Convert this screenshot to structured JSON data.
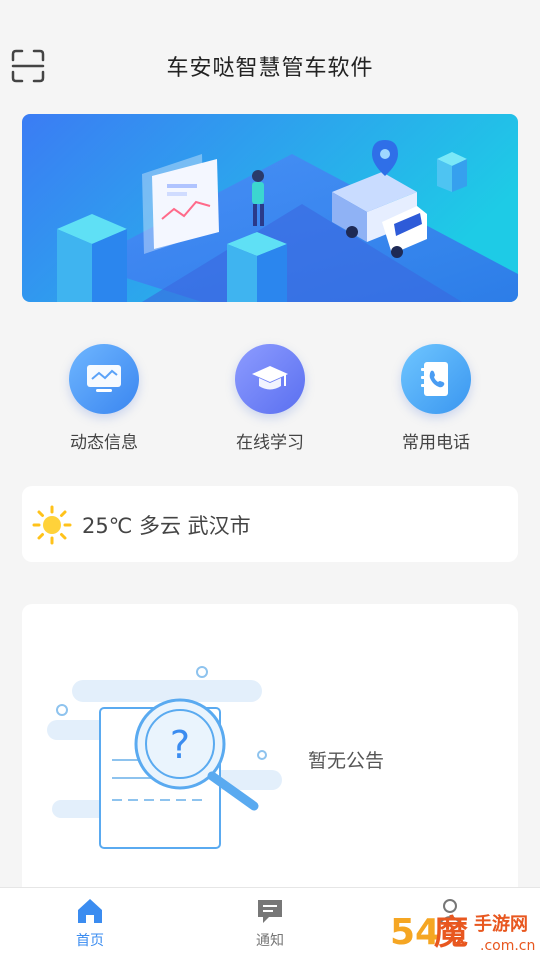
{
  "header": {
    "title": "车安哒智慧管车软件",
    "scan_icon": "scan-icon"
  },
  "quick_menu": [
    {
      "label": "动态信息",
      "icon": "monitor-icon"
    },
    {
      "label": "在线学习",
      "icon": "graduation-cap-icon"
    },
    {
      "label": "常用电话",
      "icon": "phone-book-icon"
    }
  ],
  "weather": {
    "icon": "sun-icon",
    "text": "25℃ 多云 武汉市"
  },
  "notice": {
    "empty_text": "暂无公告",
    "illustration": "magnifier-question-document-illustration"
  },
  "tabbar": [
    {
      "label": "首页",
      "icon": "home-icon",
      "active": true
    },
    {
      "label": "通知",
      "icon": "message-icon",
      "active": false
    },
    {
      "label": "",
      "icon": "user-icon",
      "active": false
    }
  ],
  "watermark": {
    "text": "54魔手游网 .com.cn"
  },
  "colors": {
    "accent": "#3b8cf0",
    "banner_from": "#3a7bf5",
    "banner_to": "#1ec8e8",
    "background": "#f5f5f5"
  }
}
